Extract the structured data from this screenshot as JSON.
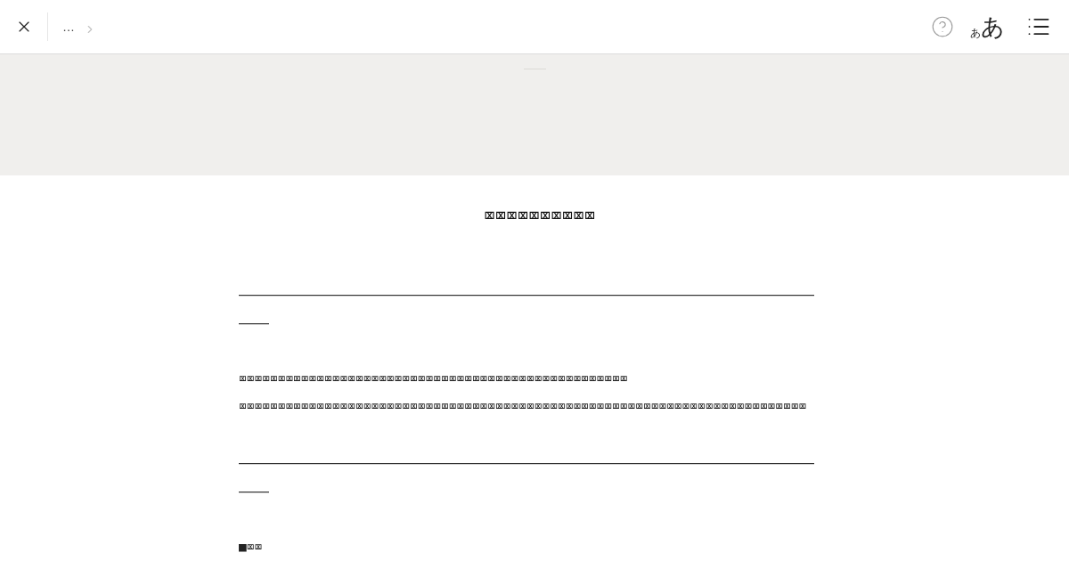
{
  "header": {
    "breadcrumb": {
      "ellipsis": "…"
    },
    "font_size_toggle": {
      "small": "あ",
      "large": "あ"
    }
  },
  "article": {
    "title": "⌧⌧⌧⌧⌧⌧⌧⌧⌧⌧",
    "blocks": [
      {
        "kind": "rule",
        "text": "――――――――――――――――――――――――――――――――――――――――"
      },
      {
        "kind": "lines",
        "lines": [
          "⌧⌧⌧⌧⌧⌧⌧⌧⌧⌧⌧⌧⌧⌧⌧⌧⌧⌧⌧⌧⌧⌧⌧⌧⌧⌧⌧⌧⌧⌧⌧⌧⌧⌧⌧⌧⌧⌧⌧⌧⌧⌧⌧⌧⌧⌧⌧⌧⌧⌧",
          "⌧⌧⌧⌧⌧⌧⌧⌧⌧⌧⌧⌧⌧⌧⌧⌧⌧⌧⌧⌧⌧⌧⌧⌧⌧⌧⌧⌧⌧⌧⌧⌧⌧⌧⌧⌧⌧⌧⌧⌧⌧⌧⌧⌧⌧⌧⌧⌧⌧⌧⌧⌧⌧⌧⌧⌧⌧⌧⌧⌧⌧⌧⌧⌧⌧⌧⌧⌧⌧⌧⌧⌧⌧"
        ]
      },
      {
        "kind": "rule",
        "text": "――――――――――――――――――――――――――――――――――――――――"
      },
      {
        "kind": "lines",
        "lines": [
          "■⌧⌧"
        ]
      }
    ]
  }
}
